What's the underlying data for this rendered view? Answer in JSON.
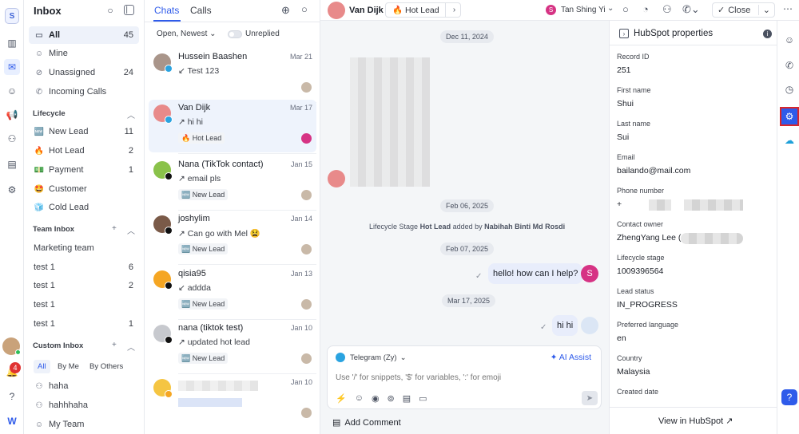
{
  "workspace_letter": "S",
  "notification_count": "4",
  "sidebar": {
    "title": "Inbox",
    "items": [
      {
        "label": "All",
        "count": "45"
      },
      {
        "label": "Mine",
        "count": ""
      },
      {
        "label": "Unassigned",
        "count": "24"
      },
      {
        "label": "Incoming Calls",
        "count": ""
      }
    ],
    "lifecycle_title": "Lifecycle",
    "lifecycle": [
      {
        "icon": "🆕",
        "label": "New Lead",
        "count": "11"
      },
      {
        "icon": "🔥",
        "label": "Hot Lead",
        "count": "2"
      },
      {
        "icon": "💵",
        "label": "Payment",
        "count": "1"
      },
      {
        "icon": "🤩",
        "label": "Customer",
        "count": ""
      },
      {
        "icon": "🧊",
        "label": "Cold Lead",
        "count": ""
      }
    ],
    "team_title": "Team Inbox",
    "team": [
      {
        "label": "Marketing team",
        "count": ""
      },
      {
        "label": "test 1",
        "count": "6"
      },
      {
        "label": "test 1",
        "count": "2"
      },
      {
        "label": "test 1",
        "count": ""
      },
      {
        "label": "test 1",
        "count": "1"
      }
    ],
    "custom_title": "Custom Inbox",
    "custom_filters": [
      "All",
      "By Me",
      "By Others"
    ],
    "custom": [
      {
        "label": "haha"
      },
      {
        "label": "hahhhaha"
      },
      {
        "label": "My Team"
      }
    ]
  },
  "chats": {
    "tabs": [
      "Chats",
      "Calls"
    ],
    "sort_label": "Open, Newest",
    "unreplied_label": "Unreplied",
    "items": [
      {
        "name": "Hussein Baashen",
        "date": "Mar 21",
        "preview": "↙ Test 123",
        "tag": "",
        "avatar_color": "#a9958a",
        "channel": "telegram"
      },
      {
        "name": "Van Dijk",
        "date": "Mar 17",
        "preview": "↗ hi hi",
        "tag": "🔥 Hot Lead",
        "avatar_color": "#e88a8a",
        "channel": "telegram"
      },
      {
        "name": "Nana (TikTok contact)",
        "date": "Jan 15",
        "preview": "↗ email pls",
        "tag": "🆕 New Lead",
        "avatar_color": "#8ac24a",
        "channel": "tiktok"
      },
      {
        "name": "joshylim",
        "date": "Jan 14",
        "preview": "↗ Can go with Mel 😫",
        "tag": "🆕 New Lead",
        "avatar_color": "#7a5a48",
        "channel": "tiktok"
      },
      {
        "name": "qisia95",
        "date": "Jan 13",
        "preview": "↙ addda",
        "tag": "🆕 New Lead",
        "avatar_color": "#f5a623",
        "channel": "tiktok"
      },
      {
        "name": "nana (tiktok test)",
        "date": "Jan 10",
        "preview": "↗ updated hot lead",
        "tag": "🆕 New Lead",
        "avatar_color": "#c7c9ce",
        "channel": "tiktok"
      },
      {
        "name": "",
        "date": "Jan 10",
        "preview": "",
        "tag": "",
        "avatar_color": "#f5c542",
        "channel": "other"
      }
    ]
  },
  "conversation": {
    "contact_name": "Van Dijk",
    "stage_chip": "🔥 Hot Lead",
    "assignee_initial": "S",
    "assignee_name": "Tan Shing Yi",
    "close_label": "Close",
    "dates": [
      "Dec 11, 2024",
      "Feb 06, 2025",
      "Feb 07, 2025",
      "Mar 17, 2025"
    ],
    "system_prefix": "Lifecycle Stage",
    "system_stage": "Hot Lead",
    "system_mid": "added by",
    "system_actor": "Nabihah Binti Md Rosdi",
    "messages": [
      "hello! how can I help?",
      "hi hi"
    ],
    "channel_label": "Telegram (Zy)",
    "ai_label": "AI Assist",
    "composer_placeholder": "Use '/' for snippets, '$' for variables, ':' for emoji",
    "add_comment": "Add Comment"
  },
  "properties": {
    "title": "HubSpot properties",
    "fields": [
      {
        "label": "Record ID",
        "value": "251"
      },
      {
        "label": "First name",
        "value": "Shui"
      },
      {
        "label": "Last name",
        "value": "Sui"
      },
      {
        "label": "Email",
        "value": "bailando@mail.com"
      },
      {
        "label": "Phone number",
        "value": "+"
      },
      {
        "label": "Contact owner",
        "value": "ZhengYang Lee ("
      },
      {
        "label": "Lifecycle stage",
        "value": "1009396564"
      },
      {
        "label": "Lead status",
        "value": "IN_PROGRESS"
      },
      {
        "label": "Preferred language",
        "value": "en"
      },
      {
        "label": "Country",
        "value": "Malaysia"
      },
      {
        "label": "Created date",
        "value": ""
      }
    ],
    "view_label": "View in HubSpot"
  },
  "colors": {
    "accent": "#2f5bea",
    "hubspot_highlight": "#d9262b",
    "assignee": "#d63384"
  }
}
